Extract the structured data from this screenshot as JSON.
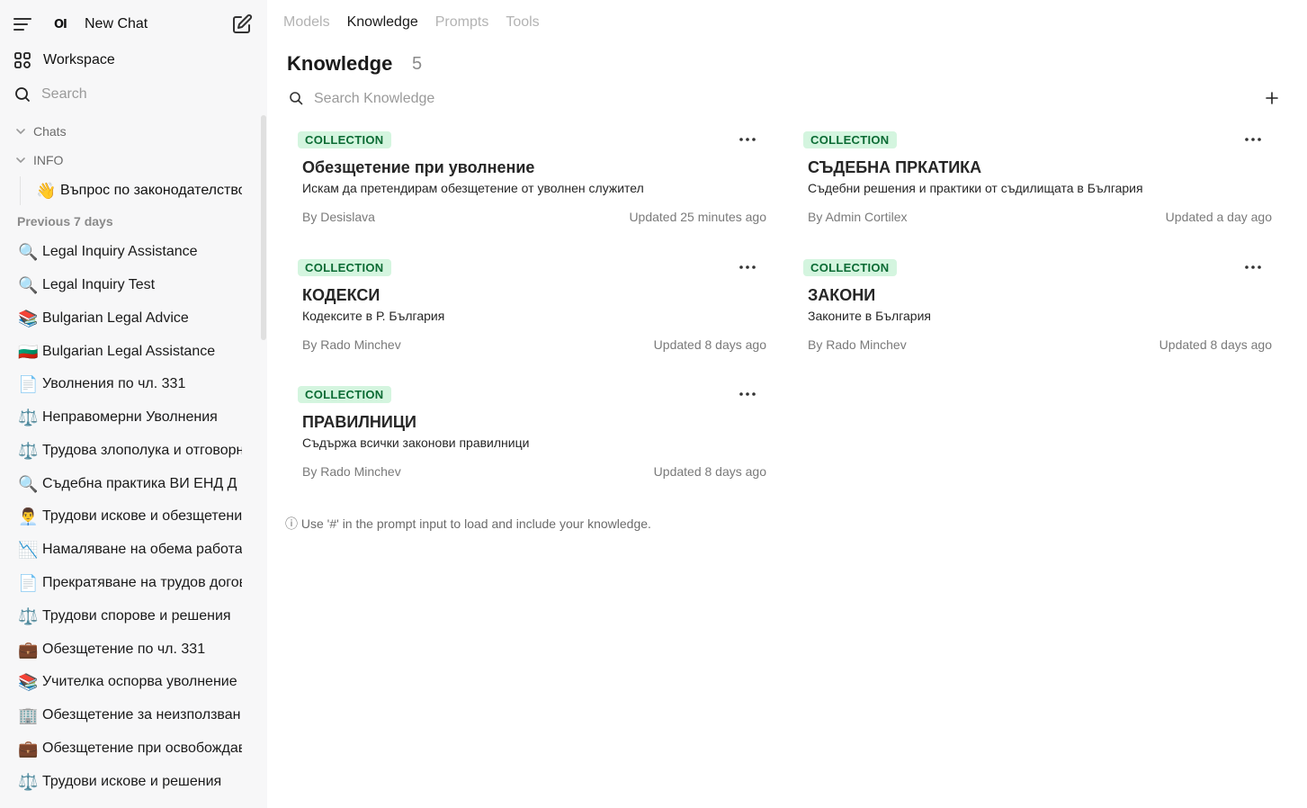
{
  "sidebar": {
    "new_chat_label": "New Chat",
    "logo_text": "OI",
    "workspace_label": "Workspace",
    "search_label": "Search",
    "folders": [
      {
        "label": "Chats"
      },
      {
        "label": "INFO"
      }
    ],
    "info_item": {
      "emoji": "👋",
      "label": "Въпрос по законодателство"
    },
    "section_label": "Previous 7 days",
    "chats": [
      {
        "emoji": "🔍",
        "label": "Legal Inquiry Assistance"
      },
      {
        "emoji": "🔍",
        "label": "Legal Inquiry Test"
      },
      {
        "emoji": "📚",
        "label": "Bulgarian Legal Advice"
      },
      {
        "emoji": "🇧🇬",
        "label": "Bulgarian Legal Assistance"
      },
      {
        "emoji": "📄",
        "label": "Уволнения по чл. 331"
      },
      {
        "emoji": "⚖️",
        "label": "Неправомерни Уволнения"
      },
      {
        "emoji": "⚖️",
        "label": "Трудова злополука и отговорност"
      },
      {
        "emoji": "🔍",
        "label": "Съдебна практика ВИ ЕНД Д"
      },
      {
        "emoji": "👨‍💼",
        "label": "Трудови искове и обезщетения"
      },
      {
        "emoji": "📉",
        "label": "Намаляване на обема работа"
      },
      {
        "emoji": "📄",
        "label": "Прекратяване на трудов договор"
      },
      {
        "emoji": "⚖️",
        "label": "Трудови спорове и решения"
      },
      {
        "emoji": "💼",
        "label": "Обезщетение по чл. 331"
      },
      {
        "emoji": "📚",
        "label": "Учителка оспорва уволнение"
      },
      {
        "emoji": "🏢",
        "label": "Обезщетение за неизползван отпуск"
      },
      {
        "emoji": "💼",
        "label": "Обезщетение при освобождаване"
      },
      {
        "emoji": "⚖️",
        "label": "Трудови искове и решения"
      }
    ]
  },
  "tabs": [
    {
      "label": "Models"
    },
    {
      "label": "Knowledge"
    },
    {
      "label": "Prompts"
    },
    {
      "label": "Tools"
    }
  ],
  "page": {
    "title": "Knowledge",
    "count": "5",
    "search_placeholder": "Search Knowledge",
    "hint": "ⓘ Use '#' in the prompt input to load and include your knowledge."
  },
  "cards": [
    {
      "badge": "COLLECTION",
      "title": "Обезщетение при уволнение",
      "description": "Искам да претендирам обезщетение от уволнен служител",
      "author": "By Desislava",
      "updated": "Updated 25 minutes ago"
    },
    {
      "badge": "COLLECTION",
      "title": "СЪДЕБНА ПРКАТИКА",
      "description": "Съдебни решения и практики от съдилищата в България",
      "author": "By Admin Cortilex",
      "updated": "Updated a day ago"
    },
    {
      "badge": "COLLECTION",
      "title": "КОДЕКСИ",
      "description": "Кодексите в Р. България",
      "author": "By Rado Minchev",
      "updated": "Updated 8 days ago"
    },
    {
      "badge": "COLLECTION",
      "title": "ЗАКОНИ",
      "description": "Законите в България",
      "author": "By Rado Minchev",
      "updated": "Updated 8 days ago"
    },
    {
      "badge": "COLLECTION",
      "title": "ПРАВИЛНИЦИ",
      "description": "Съдържа всички законови правилници",
      "author": "By Rado Minchev",
      "updated": "Updated 8 days ago"
    }
  ]
}
